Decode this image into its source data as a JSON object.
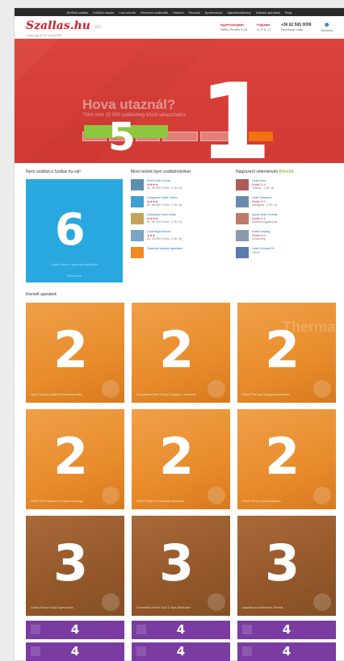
{
  "topnav": [
    "Belföldi szállás",
    "Külföldi utazás",
    "Last minute",
    "Wellness szállodák",
    "Hotelek",
    "Panziók",
    "Apartmanok",
    "Ajándékutalvány",
    "Utazási ajánlatok",
    "Blog"
  ],
  "header": {
    "logo": "Szallas.hu",
    "logo_sub": "Csak egy jó hír a belföldi",
    "flag": "EN",
    "contact1_label": "ügyfélszolgálat",
    "contact1_value": "Hétfő–Péntek 9-18",
    "contact2_label": "Foglalás",
    "contact2_value": "H–P 9–17",
    "phone": "+36 62 565 0099",
    "phone_sub": "Facebook oldal",
    "login_label": "Belépés"
  },
  "hero": {
    "title": "Hova utaznál?",
    "subtitle": "Több mint 15 000 szálláshely közül választhatsz",
    "numbers": {
      "main": "1",
      "search": "5"
    }
  },
  "sections": {
    "left_title": "Nyeri szállást a Szallas.hu-val!",
    "promo_number": "6",
    "promo_text": "Vegyél részt a nyereményjátékon",
    "promo_link": "Részletek",
    "mid_title": "Most néztek ilyen szálláshelyeket",
    "right_title": "Nagyszerű vélemények",
    "right_highlight": "Bővebb"
  },
  "mid_list": [
    {
      "title": "Park Hotel Gyula",
      "stars": "★★★★",
      "meta": "Ár: 45 000 Ft-tól / 2 fő / éj"
    },
    {
      "title": "Hunguest Hotel Pelion",
      "stars": "★★★★",
      "meta": "Ár: 38 500 Ft-tól / 2 fő / éj"
    },
    {
      "title": "Danubius Hotel Helia",
      "stars": "★★★★",
      "meta": "Ár: 52 000 Ft-tól / 2 fő / éj"
    },
    {
      "title": "Club Aliga Resort",
      "stars": "★★★",
      "meta": "Ár: 29 900 Ft-tól / 2 fő / éj"
    },
    {
      "title": "Szálloda további ajánlatok",
      "stars": "",
      "meta": ""
    }
  ],
  "right_list": [
    {
      "title": "Hotel Azúr",
      "stars": "Kiváló 9.4",
      "meta": "Tihany - 2 fő / éj"
    },
    {
      "title": "Hotel Silvanus",
      "stars": "Kiváló 9.2",
      "meta": "Visegrád - 2 fő / éj"
    },
    {
      "title": "Aqua Hotel Termál",
      "stars": "Kiváló 9.1",
      "meta": "Mosonmagyaróvár"
    },
    {
      "title": "Hotel Kristály",
      "stars": "Kiváló 9.0",
      "meta": "Keszthely"
    },
    {
      "title": "Hotel Európa Fit",
      "stars": "",
      "meta": "Hévíz"
    }
  ],
  "offers": {
    "title": "Kiemelt ajánlatok",
    "cards": [
      {
        "num": "2",
        "caption": "Hotel Palota Lillafüred Kastélyszálló",
        "style": "orange",
        "watermark": ""
      },
      {
        "num": "2",
        "caption": "Hunguest Hotel Forrás Szeged - wellness",
        "style": "orange",
        "watermark": ""
      },
      {
        "num": "2",
        "caption": "Hotel Thermal Visegrád wellness",
        "style": "orange",
        "watermark": "Thermal"
      },
      {
        "num": "2",
        "caption": "Hotel Zenit Balaton Vonyarcvashegy",
        "style": "orange",
        "watermark": ""
      },
      {
        "num": "2",
        "caption": "Hotel Helikon Keszthely wellness",
        "style": "orange",
        "watermark": ""
      },
      {
        "num": "2",
        "caption": "Hotel Karos Spa Zalakaros",
        "style": "orange",
        "watermark": ""
      },
      {
        "num": "3",
        "caption": "Saliris Resort Spa Egerszalók",
        "style": "brown",
        "watermark": ""
      },
      {
        "num": "3",
        "caption": "Greenfield Hotel Golf & Spa Bükfürdő",
        "style": "brown",
        "watermark": ""
      },
      {
        "num": "3",
        "caption": "Aquaticum Debrecen Termál",
        "style": "brown",
        "watermark": ""
      }
    ],
    "mini": [
      "4",
      "4",
      "4",
      "4",
      "4",
      "4"
    ]
  },
  "colors": {
    "brand": "#d3202a",
    "hero": "#d64840",
    "green": "#8dc63f",
    "promo": "#29a8e0",
    "orange": "#e88c2c",
    "brown": "#94572a",
    "purple": "#7a3ca0"
  }
}
